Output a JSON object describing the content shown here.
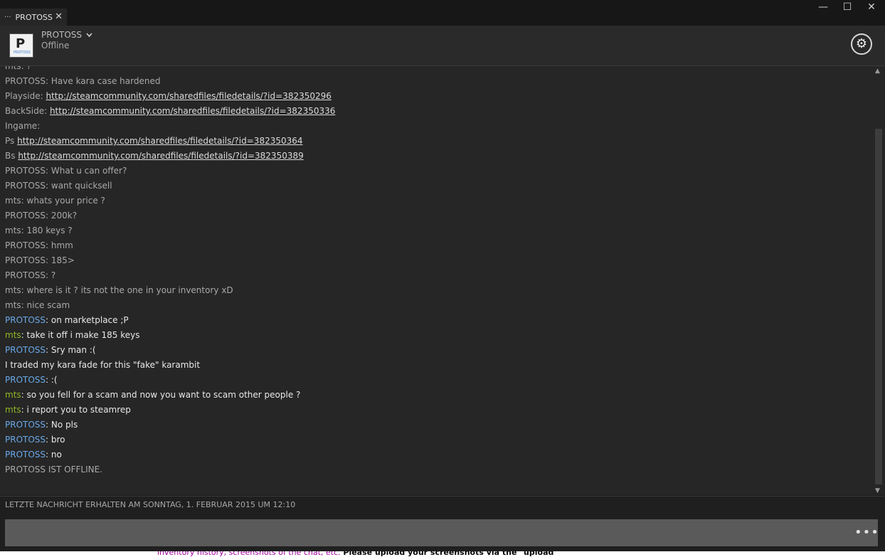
{
  "tab": {
    "label": "PROTOSS",
    "grip": "···",
    "close": "✕"
  },
  "window_controls": {
    "minimize": "—",
    "maximize": "☐",
    "close": "✕"
  },
  "header": {
    "avatar_logo_glyph": "P",
    "avatar_logo_text": "PROTOSS",
    "username": "PROTOSS",
    "status": "Offline"
  },
  "chat": {
    "lines": [
      {
        "prefix": "mts: ?"
      },
      {
        "prefix": "PROTOSS: Have kara case hardened"
      },
      {
        "prefix": "Playside: ",
        "link": "http://steamcommunity.com/sharedfiles/filedetails/?id=382350296"
      },
      {
        "prefix": "BackSide: ",
        "link": "http://steamcommunity.com/sharedfiles/filedetails/?id=382350336"
      },
      {
        "prefix": "Ingame:"
      },
      {
        "prefix": "Ps ",
        "link": "http://steamcommunity.com/sharedfiles/filedetails/?id=382350364"
      },
      {
        "prefix": "Bs ",
        "link": "http://steamcommunity.com/sharedfiles/filedetails/?id=382350389"
      },
      {
        "prefix": "PROTOSS: What u can offer?"
      },
      {
        "prefix": "PROTOSS: want quicksell"
      },
      {
        "prefix": "mts: whats your price ?"
      },
      {
        "prefix": "PROTOSS: 200k?"
      },
      {
        "prefix": "mts: 180 keys ?"
      },
      {
        "prefix": "PROTOSS: hmm"
      },
      {
        "prefix": "PROTOSS: 185>"
      },
      {
        "prefix": "PROTOSS: ?"
      },
      {
        "prefix": "mts: where is it ? its not the one in your inventory xD"
      },
      {
        "prefix": "mts: nice scam"
      },
      {
        "name": "PROTOSS",
        "who": "protoss",
        "text": ": on marketplace ;P"
      },
      {
        "name": "mts",
        "who": "mts",
        "text": ": take it off i make 185 keys"
      },
      {
        "name": "PROTOSS",
        "who": "protoss",
        "text": ": Sry man :("
      },
      {
        "plain_white": "I traded my kara fade for this \"fake\" karambit"
      },
      {
        "name": "PROTOSS",
        "who": "protoss",
        "text": ": :("
      },
      {
        "name": "mts",
        "who": "mts",
        "text": ": so you fell for a scam and now you want to scam other people ?"
      },
      {
        "name": "mts",
        "who": "mts",
        "text": ": i report you to steamrep"
      },
      {
        "name": "PROTOSS",
        "who": "protoss",
        "text": ": No pls"
      },
      {
        "name": "PROTOSS",
        "who": "protoss",
        "text": ": bro"
      },
      {
        "name": "PROTOSS",
        "who": "protoss",
        "text": ": no"
      },
      {
        "prefix": "PROTOSS IST OFFLINE."
      }
    ]
  },
  "footer": {
    "last_message": "LETZTE NACHRICHT ERHALTEN AM SONNTAG, 1. FEBRUAR 2015 UM 12:10"
  },
  "input": {
    "value": "",
    "more_label": "•••"
  },
  "background_peek": {
    "part1": "inventory history, screenshots of the chat, etc.",
    "part2": " Please upload your screenshots via the \"upload"
  },
  "colors": {
    "protoss_name": "#6aa9ea",
    "mts_name": "#8fb824",
    "chat_bg": "#262626"
  }
}
